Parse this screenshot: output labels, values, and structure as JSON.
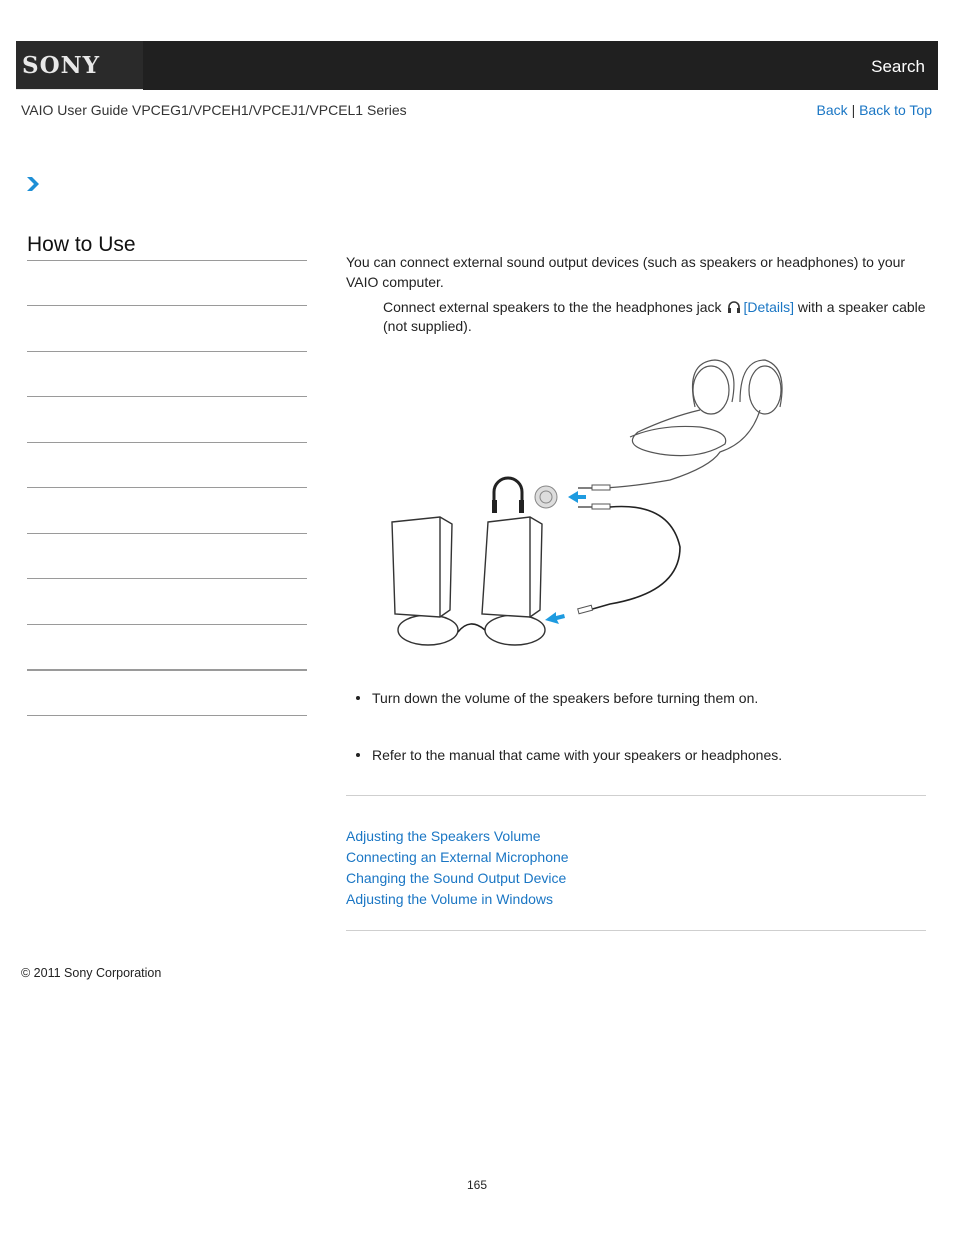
{
  "header": {
    "logo": "SONY",
    "search_label": "Search"
  },
  "guide_title": "VAIO User Guide VPCEG1/VPCEH1/VPCEJ1/VPCEL1 Series",
  "topnav": {
    "back_label": "Back",
    "separator": "|",
    "back_to_top_label": "Back to Top"
  },
  "sidebar": {
    "title": "How to Use",
    "item_count": 10
  },
  "content": {
    "intro": "You can connect external sound output devices (such as speakers or headphones) to your VAIO computer.",
    "step_before": "Connect external speakers to the the headphones jack",
    "step_link": "[Details]",
    "step_after": " with a speaker cable (not supplied).",
    "illustration_alt": "Speakers and headphones connected to headphones jack",
    "notes": [
      "Turn down the volume of the speakers before turning them on.",
      "Refer to the manual that came with your speakers or headphones."
    ]
  },
  "related_links": [
    "Adjusting the Speakers Volume",
    "Connecting an External Microphone",
    "Changing the Sound Output Device",
    "Adjusting the Volume in Windows"
  ],
  "footer": {
    "copyright": "© 2011 Sony Corporation",
    "page_number": "165"
  },
  "colors": {
    "header_bg": "#202020",
    "link": "#1a76c4",
    "arrow": "#1e9be0"
  }
}
